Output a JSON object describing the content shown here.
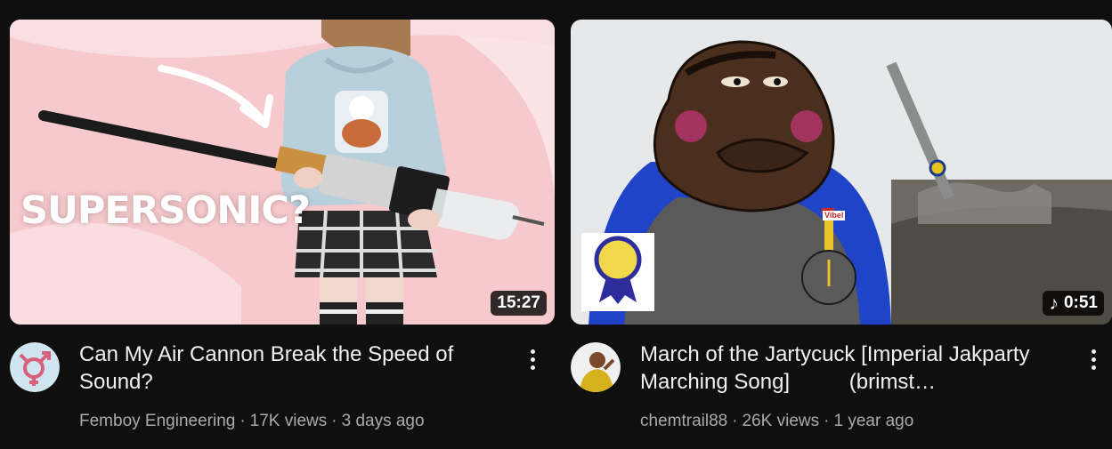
{
  "videos": [
    {
      "title": "Can My Air Cannon Break the Speed of Sound?",
      "channel": "Femboy Engineering",
      "views": "17K views",
      "age": "3 days ago",
      "duration": "15:27",
      "thumbnail_text": "SUPERSONIC?",
      "avatar_icon": "gender-symbol-icon",
      "colors": {
        "thumb_bg": "#f6c9cc",
        "avatar_bg": "#cfe5ef",
        "avatar_fg": "#d9607a"
      }
    },
    {
      "title": "March of the Jartycuck [Imperial Jakparty Marching Song]          (brimst…",
      "channel": "chemtrail88",
      "views": "26K views",
      "age": "1 year ago",
      "duration": "0:51",
      "duration_icon": "music-note-icon",
      "thumbnail_badge_text": "Vibel",
      "colors": {
        "thumb_bg": "#e7e8ea",
        "jacket": "#1f44c7",
        "face": "#4b2f1e",
        "blush": "#b7356e"
      }
    }
  ],
  "separator": "·"
}
